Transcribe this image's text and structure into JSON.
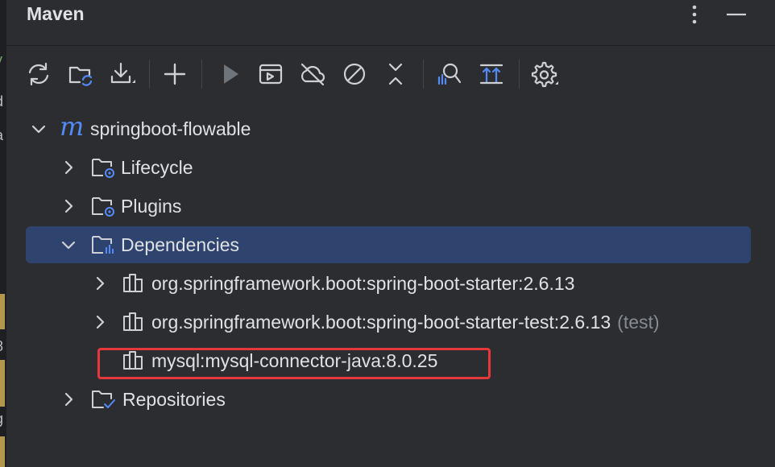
{
  "panel": {
    "title": "Maven"
  },
  "colors": {
    "background": "#2b2d30",
    "selection": "#2e436e",
    "accent": "#548af7",
    "highlight_border": "#e5383b",
    "scope_text": "#868a91"
  },
  "header": {
    "icons": [
      "more-options-icon",
      "minimize-icon"
    ]
  },
  "toolbar": {
    "buttons": [
      "reload-icon",
      "reload-folder-icon",
      "download-icon",
      "add-icon",
      "run-icon",
      "execute-goal-icon",
      "offline-icon",
      "skip-tests-icon",
      "collapse-icon",
      "analyze-dependencies-icon",
      "show-dependencies-icon",
      "settings-icon"
    ]
  },
  "tree": {
    "project": {
      "name": "springboot-flowable",
      "icon_glyph": "m"
    },
    "nodes": [
      {
        "label": "Lifecycle"
      },
      {
        "label": "Plugins"
      },
      {
        "label": "Dependencies"
      },
      {
        "label": "Repositories"
      }
    ],
    "dependencies": [
      {
        "label": "org.springframework.boot:spring-boot-starter:2.6.13",
        "scope": ""
      },
      {
        "label": "org.springframework.boot:spring-boot-starter-test:2.6.13",
        "scope": "(test)"
      },
      {
        "label": "mysql:mysql-connector-java:8.0.25",
        "scope": ""
      }
    ]
  }
}
